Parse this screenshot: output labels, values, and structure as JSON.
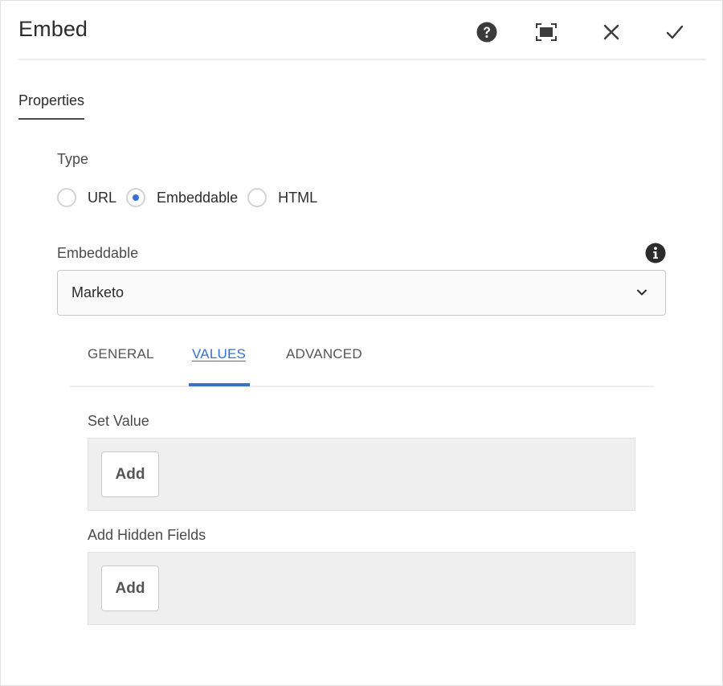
{
  "dialog": {
    "title": "Embed",
    "header_buttons": {
      "help_icon": "help-circle-icon",
      "fullscreen_icon": "fullscreen-icon",
      "cancel_icon": "close-icon",
      "done_icon": "checkmark-icon"
    }
  },
  "tabs": {
    "properties_label": "Properties"
  },
  "type_field": {
    "label": "Type",
    "options": [
      {
        "label": "URL",
        "checked": false
      },
      {
        "label": "Embeddable",
        "checked": true
      },
      {
        "label": "HTML",
        "checked": false
      }
    ]
  },
  "embeddable_field": {
    "label": "Embeddable",
    "selected_value": "Marketo",
    "info_icon": "info-icon"
  },
  "inner_tabs": {
    "general": "GENERAL",
    "values": "VALUES",
    "advanced": "ADVANCED",
    "active": "VALUES"
  },
  "set_value": {
    "label": "Set Value",
    "add_label": "Add"
  },
  "hidden_fields": {
    "label": "Add Hidden Fields",
    "add_label": "Add"
  },
  "colors": {
    "accent": "#3a6fd0",
    "text": "#2c2c2c",
    "panel_bg": "#efefef"
  }
}
